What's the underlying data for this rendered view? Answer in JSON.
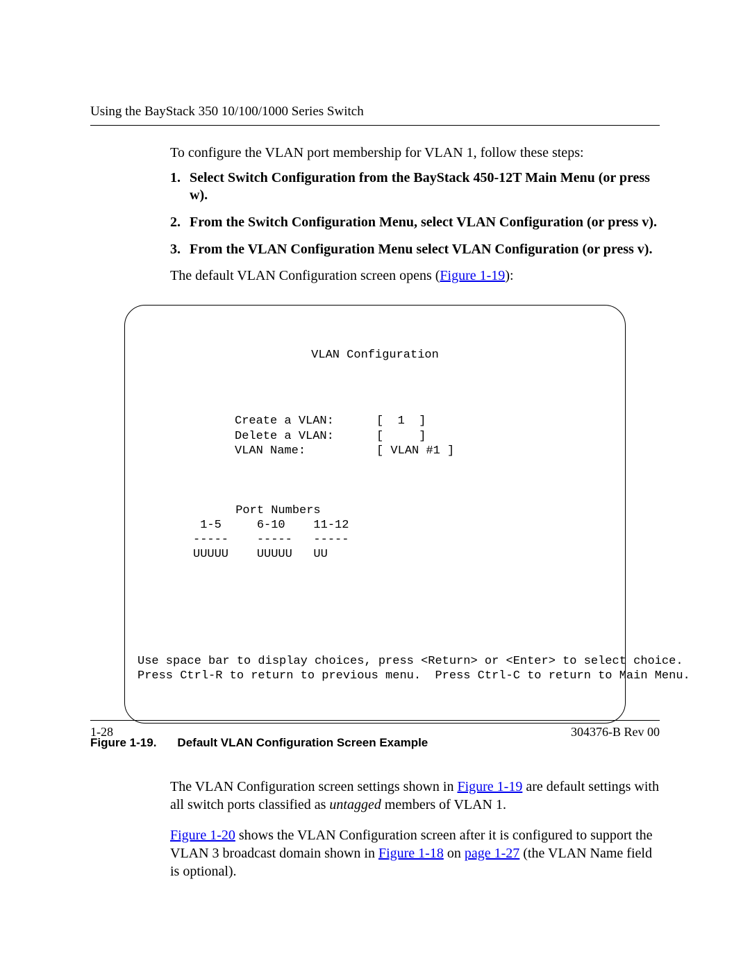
{
  "header": {
    "running_head": "Using the BayStack 350 10/100/1000 Series Switch"
  },
  "intro": "To configure the VLAN port membership for VLAN 1, follow these steps:",
  "steps": [
    {
      "num": "1.",
      "text": "Select Switch Configuration from the BayStack 450-12T Main Menu (or press w)."
    },
    {
      "num": "2.",
      "text": "From the Switch Configuration Menu, select VLAN Configuration (or press v)."
    },
    {
      "num": "3.",
      "text": "From the VLAN Configuration Menu select VLAN Configuration (or press v)."
    }
  ],
  "after_steps_pre": "The default VLAN Configuration screen opens (",
  "after_steps_link": "Figure 1-19",
  "after_steps_post": "):",
  "screen": {
    "title": "VLAN Configuration",
    "fields": "Create a VLAN:      [  1  ]\nDelete a VLAN:      [     ]\nVLAN Name:          [ VLAN #1 ]",
    "ports": "      Port Numbers\n 1-5     6-10    11-12\n-----    -----   -----\nUUUUU    UUUUU   UU",
    "footer": "Use space bar to display choices, press <Return> or <Enter> to select choice.\nPress Ctrl-R to return to previous menu.  Press Ctrl-C to return to Main Menu."
  },
  "caption": {
    "label": "Figure 1-19.",
    "text": "Default VLAN Configuration Screen Example"
  },
  "para1": {
    "pre": "The VLAN Configuration screen settings shown in ",
    "link": "Figure 1-19",
    "mid": " are default settings with all switch ports classified as ",
    "italic": "untagged",
    "post": " members of VLAN 1."
  },
  "para2": {
    "link1": "Figure 1-20",
    "t1": " shows the VLAN Configuration screen after it is configured to support the VLAN 3 broadcast domain shown in ",
    "link2": "Figure 1-18",
    "t2": " on ",
    "link3": "page 1-27",
    "t3": " (the VLAN Name field is optional)."
  },
  "footer": {
    "page_num": "1-28",
    "doc_id": "304376-B Rev 00"
  }
}
